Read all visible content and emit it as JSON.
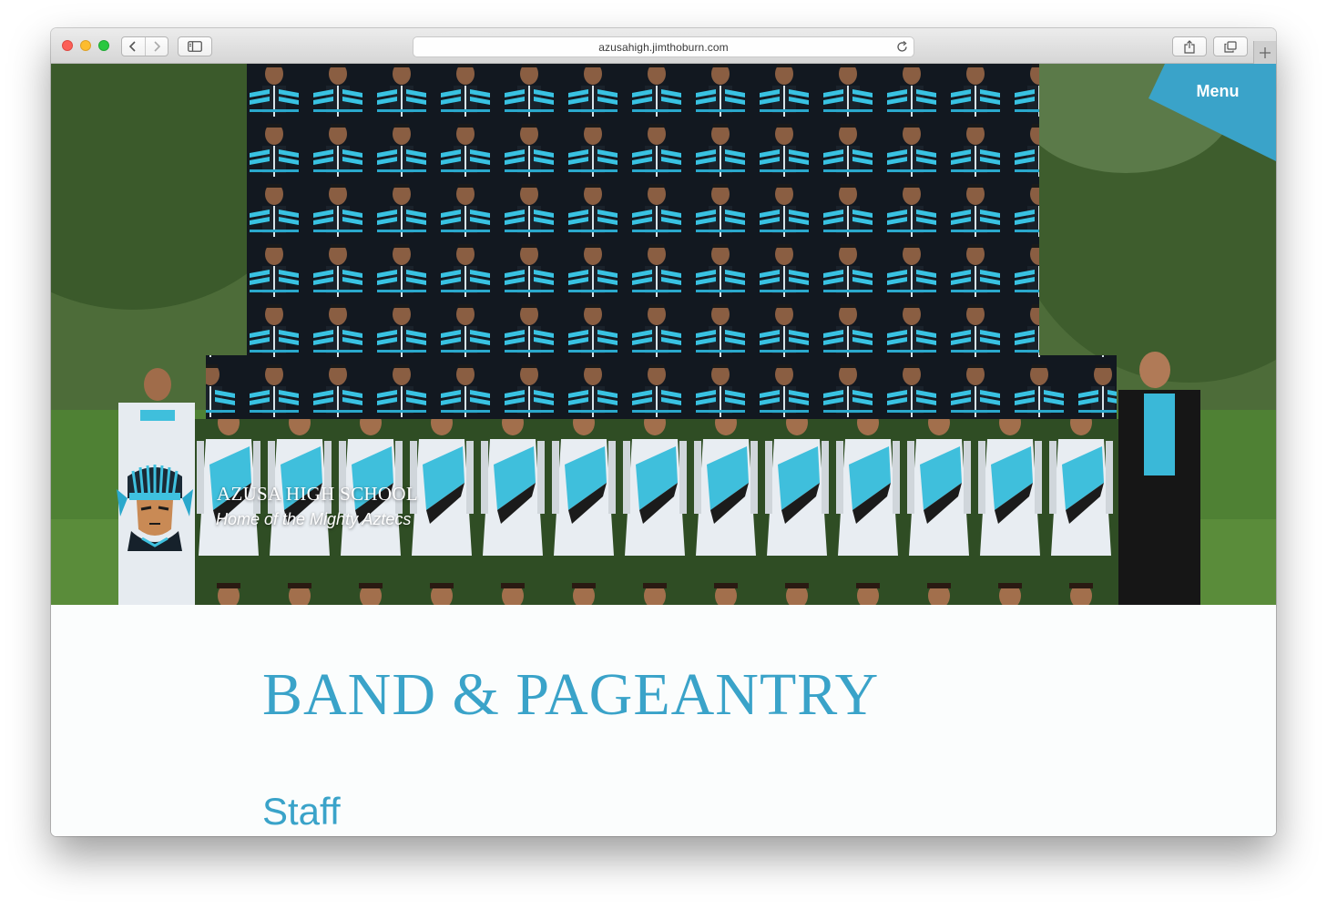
{
  "browser": {
    "url": "azusahigh.jimthoburn.com",
    "colors": {
      "close": "#fc5f57",
      "minimize": "#fdbc2e",
      "zoom": "#28c840"
    },
    "icons": [
      "back-icon",
      "forward-icon",
      "sidebar-icon",
      "reload-icon",
      "share-icon",
      "tabs-icon",
      "new-tab-icon"
    ]
  },
  "site": {
    "menu_label": "Menu",
    "name": "AZUSA HIGH SCHOOL",
    "tagline": "Home of the Mighty Aztecs",
    "accent_color": "#3aa3c9"
  },
  "content": {
    "page_title": "BAND & PAGEANTRY",
    "section_heading": "Staff"
  }
}
